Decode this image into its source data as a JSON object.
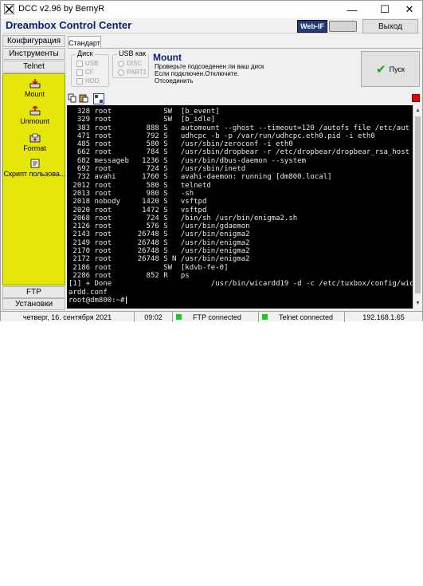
{
  "window": {
    "title": "DCC v2.96 by BernyR",
    "minimize_glyph": "—",
    "maximize_glyph": "☐",
    "close_glyph": "✕"
  },
  "banner": {
    "title": "Dreambox Control Center",
    "webif_label": "Web-IF",
    "exit_label": "Выход"
  },
  "nav": {
    "config": "Конфигурация",
    "tools": "Инструменты",
    "telnet": "Telnet",
    "ftp": "FTP",
    "settings": "Установки"
  },
  "tools": [
    {
      "label": "Mount",
      "icon": "mount-icon"
    },
    {
      "label": "Unmount",
      "icon": "unmount-icon"
    },
    {
      "label": "Format",
      "icon": "format-icon"
    },
    {
      "label": "Скрипт пользова...",
      "icon": "script-icon"
    }
  ],
  "tab": {
    "label": "Стандарт"
  },
  "disk_group": {
    "label": "Диск",
    "options": [
      "USB",
      "CF",
      "HDD"
    ]
  },
  "usb_group": {
    "label": "USB как",
    "options": [
      "DISC",
      "PART1"
    ]
  },
  "mount": {
    "title": "Mount",
    "lines": [
      "Проверьте подсоеденен ли ваш диск",
      "Если подключен.Отключите.",
      "Отсоединить"
    ],
    "go_label": "Пуск"
  },
  "terminal_lines": [
    "  328 root            SW  [b_event]",
    "  329 root            SW  [b_idle]",
    "  383 root        888 S   automount --ghost --timeout=120 /autofs file /etc/aut",
    "  471 root        792 S   udhcpc -b -p /var/run/udhcpc.eth0.pid -i eth0",
    "  485 root        580 S   /usr/sbin/zeroconf -i eth0",
    "  662 root        784 S   /usr/sbin/dropbear -r /etc/dropbear/dropbear_rsa_host",
    "  682 messageb   1236 S   /usr/bin/dbus-daemon --system",
    "  692 root        724 S   /usr/sbin/inetd",
    "  732 avahi      1760 S   avahi-daemon: running [dm800.local]",
    " 2012 root        580 S   telnetd",
    " 2013 root        980 S   -sh",
    " 2018 nobody     1420 S   vsftpd",
    " 2020 root       1472 S   vsftpd",
    " 2068 root        724 S   /bin/sh /usr/bin/enigma2.sh",
    " 2126 root        576 S   /usr/bin/gdaemon",
    " 2143 root      26748 S   /usr/bin/enigma2",
    " 2149 root      26748 S   /usr/bin/enigma2",
    " 2170 root      26748 S   /usr/bin/enigma2",
    " 2172 root      26748 S N /usr/bin/enigma2",
    " 2186 root            SW  [kdvb-fe-0]",
    " 2286 root        852 R   ps",
    "[1] + Done                       /usr/bin/wicardd19 -d -c /etc/tuxbox/config/wic",
    "ardd.conf",
    "root@dm800:~#"
  ],
  "status": {
    "date": "четверг, 16. сентября 2021",
    "time": "09:02",
    "ftp": "FTP connected",
    "telnet": "Telnet connected",
    "ip": "192.168.1.65"
  },
  "colors": {
    "yellow_panel": "#e7e60b",
    "banner_text": "#0b1f6e",
    "terminal_bg": "#000000",
    "status_ok": "#1ec81e",
    "alert": "#e60000"
  }
}
